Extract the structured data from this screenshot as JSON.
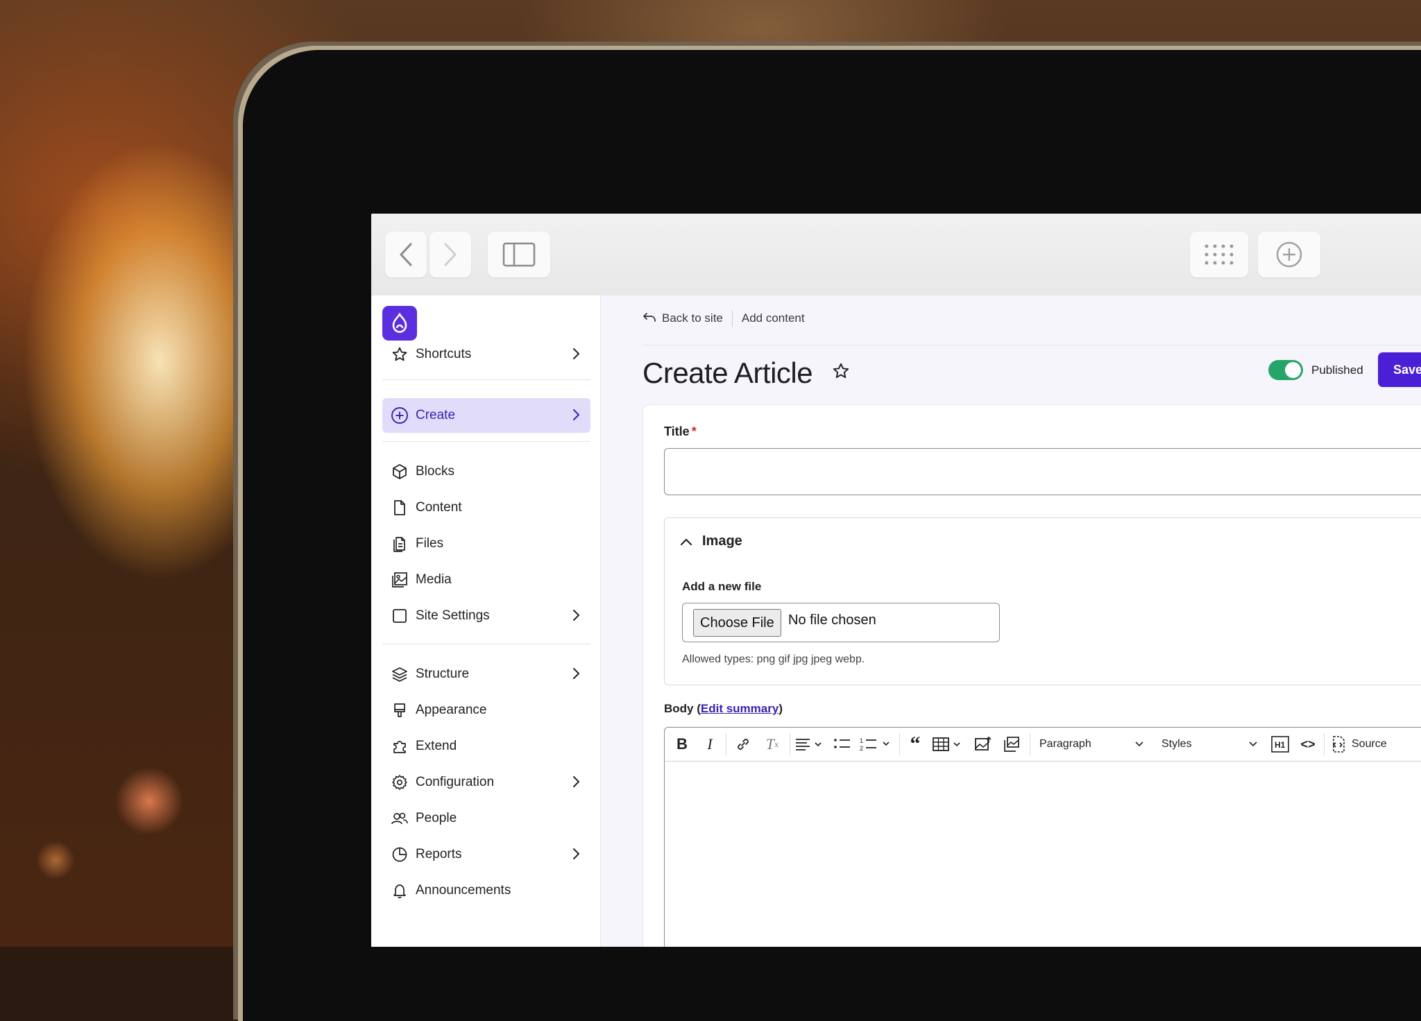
{
  "sidebar": {
    "shortcuts": "Shortcuts",
    "create": "Create",
    "blocks": "Blocks",
    "content": "Content",
    "files": "Files",
    "media": "Media",
    "site_settings": "Site Settings",
    "structure": "Structure",
    "appearance": "Appearance",
    "extend": "Extend",
    "configuration": "Configuration",
    "people": "People",
    "reports": "Reports",
    "announcements": "Announcements"
  },
  "breadcrumb": {
    "back": "Back to site",
    "current": "Add content"
  },
  "header": {
    "title": "Create Article",
    "published_label": "Published",
    "save_label": "Save"
  },
  "form": {
    "title_label": "Title",
    "required_mark": "*",
    "image_section": "Image",
    "add_file_label": "Add a new file",
    "choose_file": "Choose File",
    "no_file": "No file chosen",
    "allowed_types": "Allowed types: png gif jpg jpeg webp.",
    "body_label": "Body",
    "edit_summary": "Edit summary"
  },
  "toolbar": {
    "paragraph": "Paragraph",
    "styles": "Styles",
    "source": "Source"
  },
  "colors": {
    "accent": "#4b1fd6",
    "toggle_on": "#26a56a",
    "active_nav_bg": "#e2dcfb"
  }
}
